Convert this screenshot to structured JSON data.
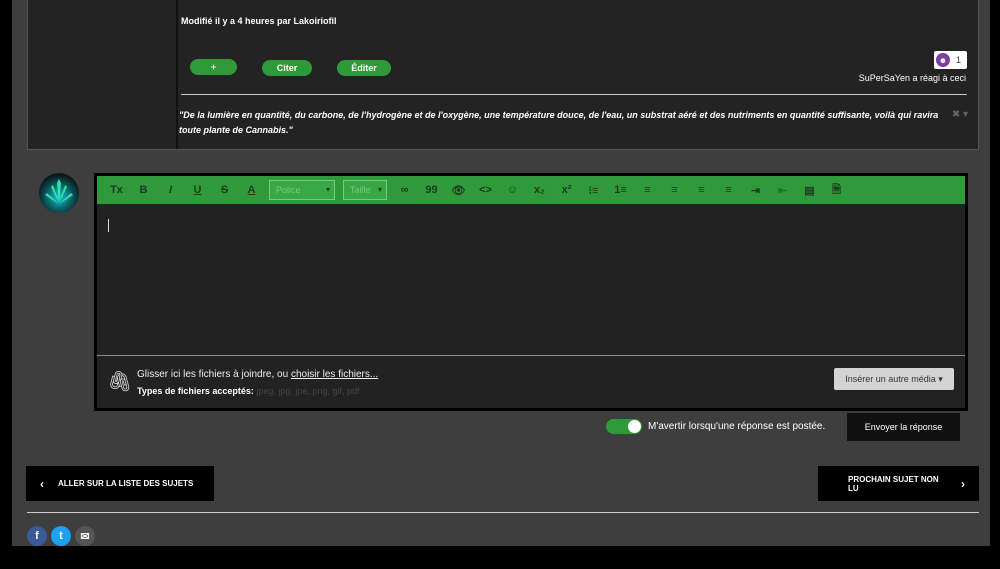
{
  "post": {
    "edited_text": "Modifié il y a 4 heures par Lakoiriofil",
    "buttons": {
      "plus": "+",
      "quote": "Citer",
      "edit": "Éditer"
    },
    "reaction": {
      "icon": "purple-reaction-icon",
      "count": "1"
    },
    "reacted_text": "SuPerSaYen a réagi à ceci",
    "signature": "\"De la lumière en quantité, du carbone, de l'hydrogène et de l'oxygène, une température douce, de l'eau, un substrat aéré et des nutriments en quantité suffisante, voilà qui ravira toute plante de Cannabis.\"",
    "sig_tools": "✖ ▾"
  },
  "editor": {
    "toolbar": {
      "clear_format": "Tx",
      "bold": "B",
      "italic": "I",
      "underline": "U",
      "strike": "S",
      "color": "A",
      "font_select": "Police",
      "size_select": "Taille",
      "link": "∞",
      "quote": "99",
      "spoiler": "👁",
      "code": "<>",
      "emoji": "☺",
      "subscript": "x₂",
      "superscript": "x²",
      "bullet_list": "⁝≡",
      "numbered_list": "1≡",
      "align_left": "≡",
      "align_center": "≡",
      "align_right": "≡",
      "justify": "≡",
      "indent": "⇥",
      "outdent": "⇤",
      "source": "▤",
      "preview": "🗎"
    },
    "attach": {
      "drop_text": "Glisser ici les fichiers à joindre, ou ",
      "choose_link": "choisir les fichiers...",
      "types_label": "Types de fichiers acceptés: ",
      "types_value": "jpeg, jpg, jpe, png, gif, pdf",
      "insert_media": "Insérer un autre média ▾"
    }
  },
  "notify_text": "M'avertir lorsqu'une réponse est postée.",
  "send_button": "Envoyer la réponse",
  "nav": {
    "prev": "ALLER SUR LA LISTE DES SUJETS",
    "next": "PROCHAIN SUJET NON LU",
    "prev_icon": "‹",
    "next_icon": "›"
  },
  "social": {
    "facebook": "f",
    "twitter": "t",
    "email": "✉"
  },
  "colors": {
    "accent_green": "#2f9a3a",
    "background": "#3e3e3e",
    "post_bg": "#232323",
    "facebook": "#3b5998",
    "twitter": "#1da1f2",
    "email": "#555555"
  }
}
